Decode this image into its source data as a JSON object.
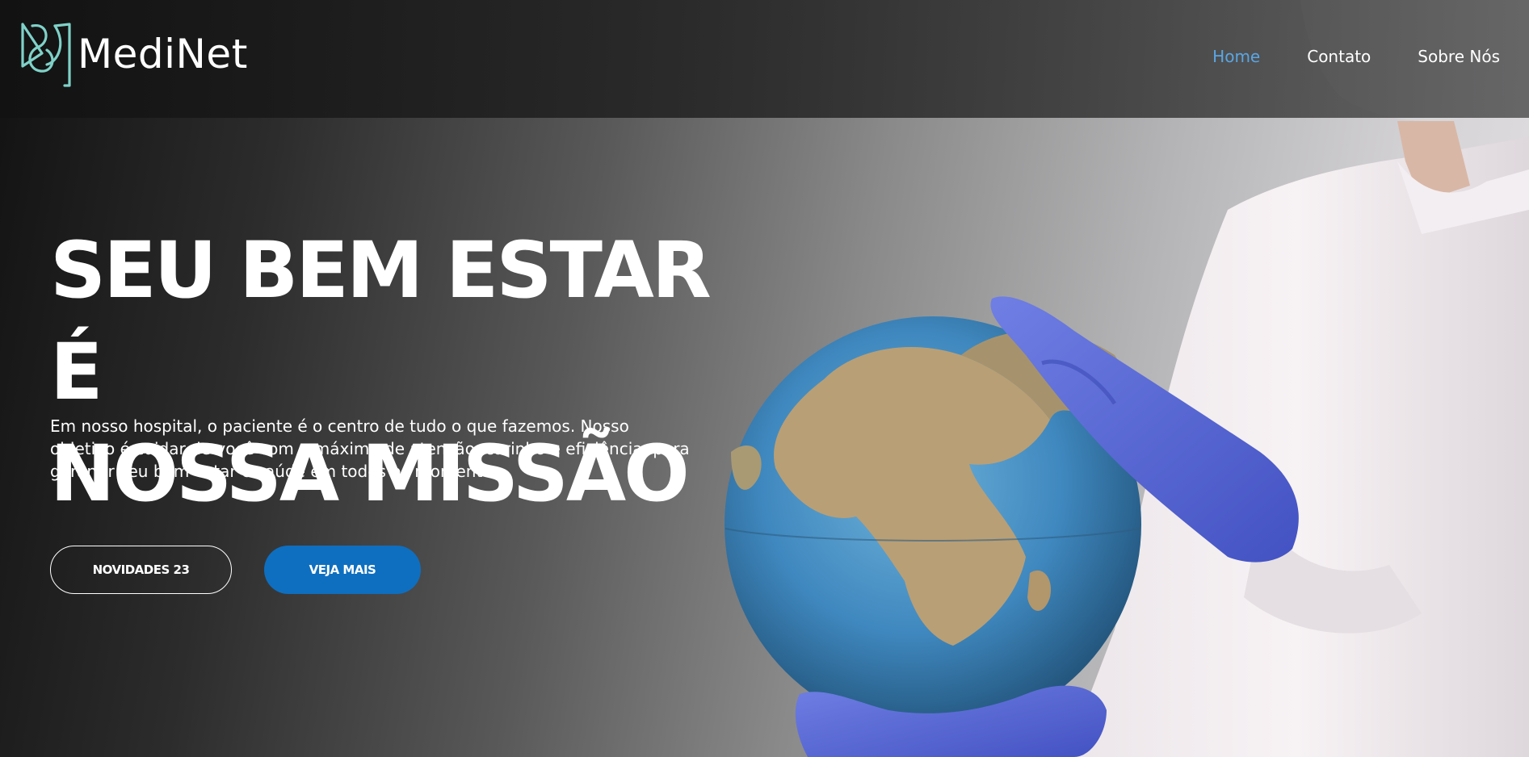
{
  "brand": {
    "name": "MediNet",
    "logo_icon": "medinet-logo-icon",
    "logo_color": "#7fd1c8"
  },
  "nav": {
    "items": [
      {
        "label": "Home",
        "active": true
      },
      {
        "label": "Contato",
        "active": false
      },
      {
        "label": "Sobre Nós",
        "active": false
      }
    ],
    "active_color": "#5aa6e3"
  },
  "hero": {
    "headline_line1": "SEU BEM ESTAR É",
    "headline_line2": "NOSSA MISSÃO",
    "lead": "Em nosso hospital, o paciente é o centro de tudo o que fazemos. Nosso objetivo é cuidar de você com o máximo de atenção, carinho e eficiência, para garantir seu bem-estar e saúde em todos os momentos.",
    "buttons": {
      "news_label": "NOVIDADES 23",
      "more_label": "VEJA MAIS",
      "more_color": "#0e6fc0"
    },
    "image": "doctor-with-gloves-holding-globe"
  }
}
